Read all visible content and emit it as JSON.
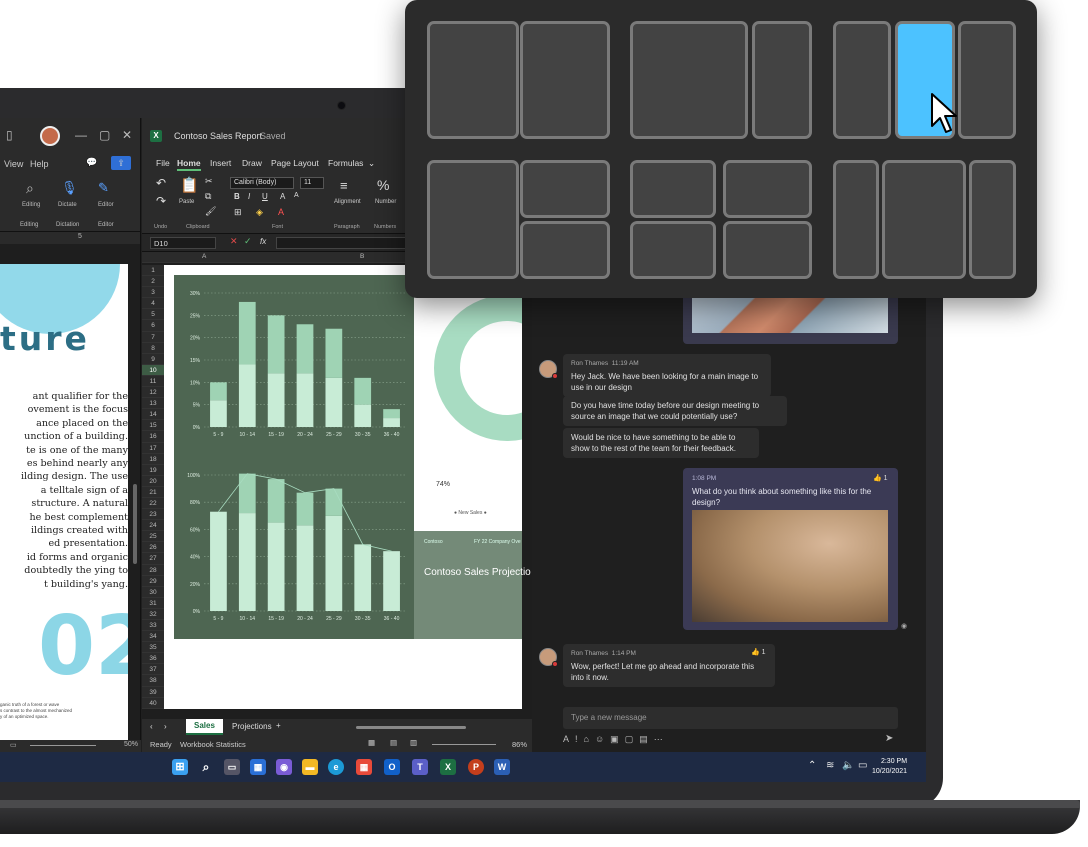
{
  "word": {
    "menu": [
      "View",
      "Help"
    ],
    "ribbon": [
      "Editing",
      "Dictate",
      "Editor"
    ],
    "ribbon_groups": [
      "Editing",
      "Dictation",
      "Editor"
    ],
    "ruler_mark": "5",
    "heading": "ture",
    "body_lines": [
      "ant qualifier for the",
      "ovement is the focus",
      "ance placed on the",
      "unction of a building.",
      "te is one of the many",
      "es behind nearly any",
      "ilding design. The use",
      "a telltale sign of a",
      "structure. A natural",
      "he best complement",
      "ildings created with",
      "ed presentation.",
      "id forms and organic",
      "doubtedly the ying to",
      "t building's yang."
    ],
    "big_number": "02",
    "footnote": "ganic truth of a forest or wave\ns contrast to the almost mechanized\ny of an optimized space.",
    "zoom": "50%"
  },
  "excel": {
    "title": "Contoso Sales Report",
    "saved": "Saved",
    "menu": [
      "File",
      "Home",
      "Insert",
      "Draw",
      "Page Layout",
      "Formulas"
    ],
    "font_name": "Calibri (Body)",
    "font_size": "11",
    "ribbon_labels": [
      "Undo",
      "Clipboard",
      "Font",
      "Paragraph",
      "Numbers"
    ],
    "ribbon_buttons": [
      "Paste",
      "Alignment",
      "Number"
    ],
    "name_box": "D10",
    "fx": "fx",
    "columns": [
      "A",
      "B"
    ],
    "rows": [
      "1",
      "2",
      "3",
      "4",
      "5",
      "6",
      "7",
      "8",
      "9",
      "10",
      "11",
      "12",
      "13",
      "14",
      "15",
      "16",
      "17",
      "18",
      "19",
      "20",
      "21",
      "22",
      "23",
      "24",
      "25",
      "26",
      "27",
      "28",
      "29",
      "30",
      "31",
      "32",
      "33",
      "34",
      "35",
      "36",
      "37",
      "38",
      "39",
      "40"
    ],
    "selected_row": "10",
    "tabs": [
      "Sales",
      "Projections"
    ],
    "status_ready": "Ready",
    "status_stats": "Workbook Statistics",
    "zoom": "86%",
    "donut_value": "74%",
    "donut_legend": "New Sales",
    "card_company": "Contoso",
    "card_year": "FY 22 Company Ove",
    "card_title": "Contoso Sales Projectio"
  },
  "chart_data": [
    {
      "type": "bar",
      "categories": [
        "5 - 9",
        "10 - 14",
        "15 - 19",
        "20 - 24",
        "25 - 29",
        "30 - 35",
        "36 - 40"
      ],
      "yticks": [
        "30%",
        "25%",
        "20%",
        "15%",
        "10%",
        "5%",
        "0%"
      ],
      "ylim": [
        0,
        30
      ],
      "series": [
        {
          "values": [
            6,
            14,
            12,
            12,
            11,
            5,
            2
          ]
        },
        {
          "values": [
            4,
            14,
            13,
            11,
            11,
            6,
            2
          ]
        }
      ]
    },
    {
      "type": "bar",
      "categories": [
        "5 - 9",
        "10 - 14",
        "15 - 19",
        "20 - 24",
        "25 - 29",
        "30 - 35",
        "36 - 40"
      ],
      "yticks": [
        "100%",
        "80%",
        "60%",
        "40%",
        "20%",
        "0%"
      ],
      "ylim": [
        0,
        100
      ],
      "series": [
        {
          "values": [
            73,
            72,
            65,
            63,
            70,
            49,
            44
          ]
        },
        {
          "values": [
            0,
            29,
            32,
            24,
            20,
            0,
            0
          ]
        }
      ]
    }
  ],
  "teams": {
    "msg1": {
      "sender": "Ron Thames",
      "time": "11:19 AM",
      "lines": [
        "Hey Jack. We have been looking for a main image to use in our design",
        "Do you have time today before our design meeting to source an image that we could potentially use?",
        "Would be nice to have something to be able to show to the rest of the team for their feedback."
      ]
    },
    "mine": {
      "time": "1:08 PM",
      "text": "What do you think about something like this for the design?",
      "reaction": "1"
    },
    "msg2": {
      "sender": "Ron Thames",
      "time": "1:14 PM",
      "text": "Wow, perfect! Let me go ahead and incorporate this into it now.",
      "reaction": "1"
    },
    "input_placeholder": "Type a new message"
  },
  "taskbar": {
    "time": "2:30 PM",
    "date": "10/20/2021"
  },
  "snap": {
    "highlight_color": "#4cc2ff"
  }
}
